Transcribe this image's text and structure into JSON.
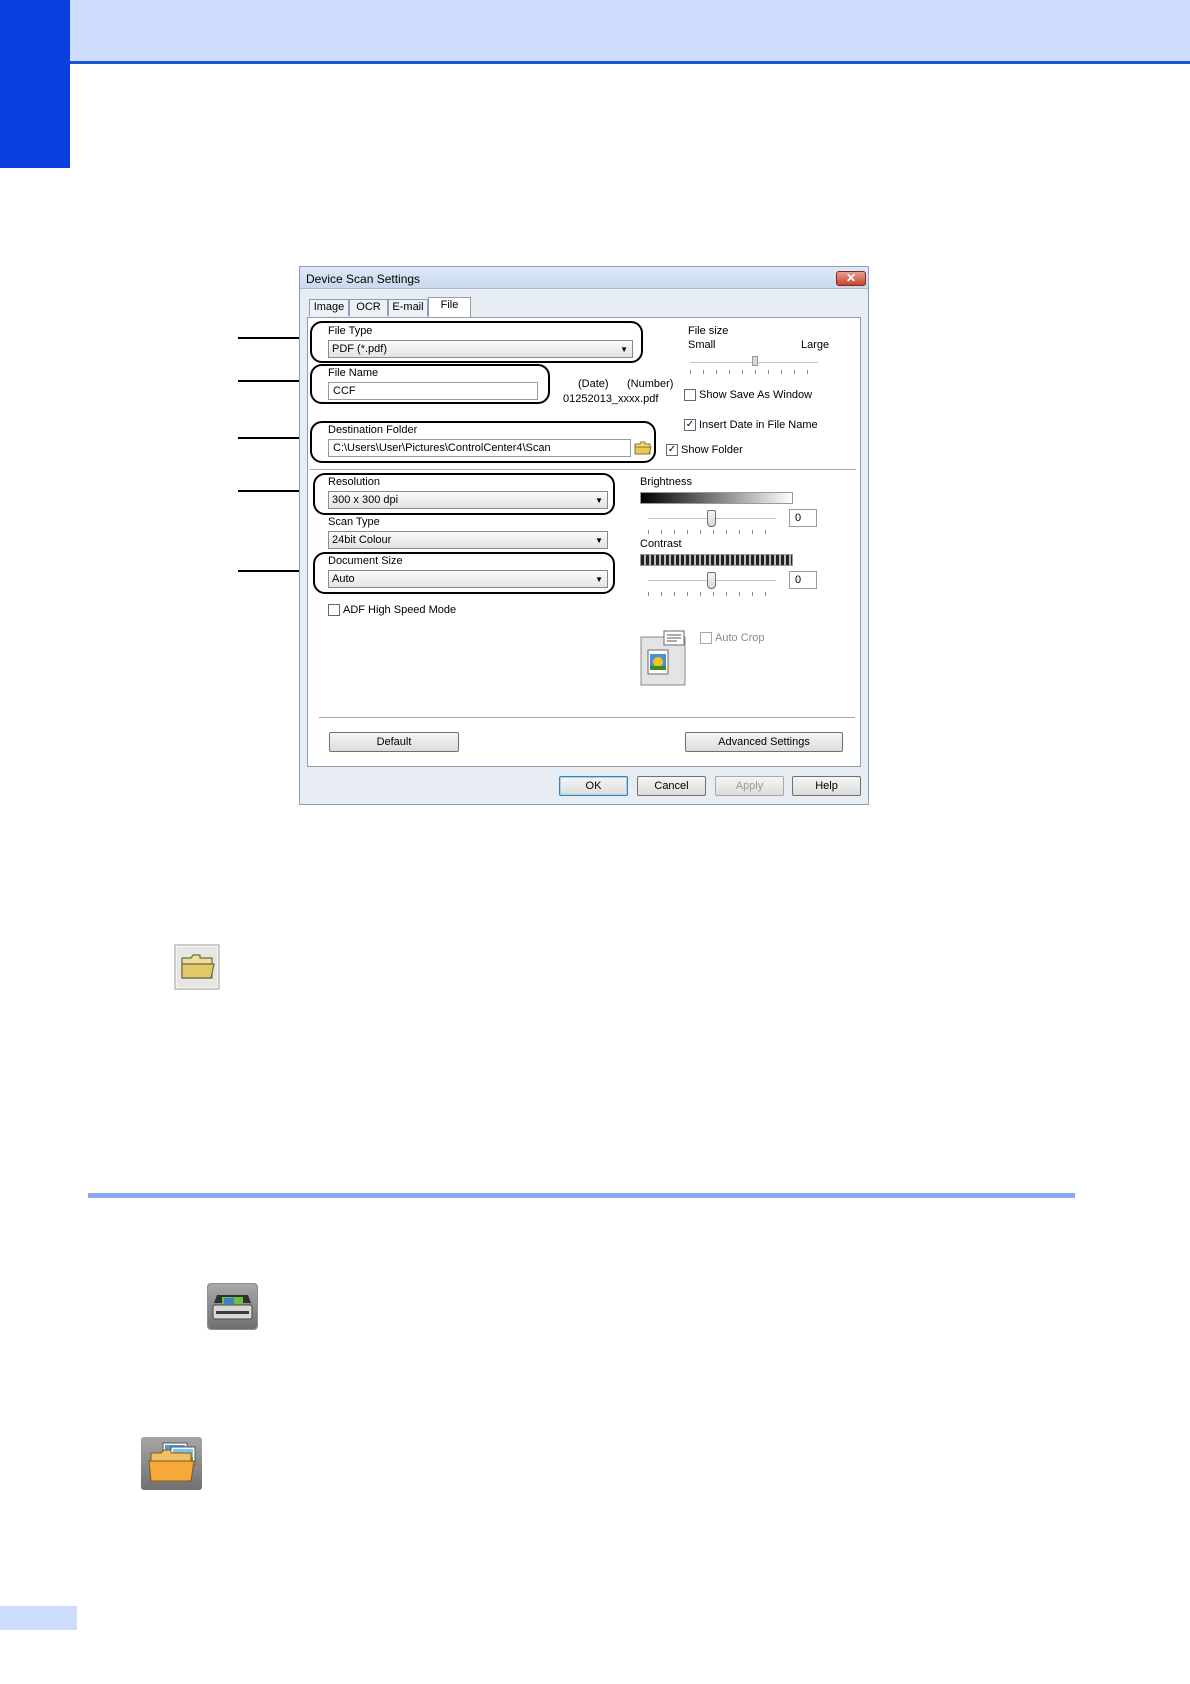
{
  "dialog": {
    "title": "Device Scan Settings",
    "close_glyph": "✕",
    "tabs": [
      {
        "label": "Image"
      },
      {
        "label": "OCR"
      },
      {
        "label": "E-mail"
      },
      {
        "label": "File"
      }
    ],
    "active_tab": "File",
    "file_type": {
      "label": "File Type",
      "value": "PDF (*.pdf)"
    },
    "file_name": {
      "label": "File Name",
      "value": "CCF"
    },
    "file_name_preview": {
      "date_label": "(Date)",
      "number_label": "(Number)",
      "example": "01252013_xxxx.pdf"
    },
    "file_size": {
      "label": "File size",
      "small_label": "Small",
      "large_label": "Large"
    },
    "show_save_as_window": {
      "label": "Show Save As Window",
      "checked": false
    },
    "insert_date": {
      "label": "Insert Date in File Name",
      "checked": true
    },
    "destination_folder": {
      "label": "Destination Folder",
      "value": "C:\\Users\\User\\Pictures\\ControlCenter4\\Scan"
    },
    "show_folder": {
      "label": "Show Folder",
      "checked": true
    },
    "resolution": {
      "label": "Resolution",
      "value": "300 x 300 dpi"
    },
    "scan_type": {
      "label": "Scan Type",
      "value": "24bit Colour"
    },
    "document_size": {
      "label": "Document Size",
      "value": "Auto"
    },
    "adf_high_speed": {
      "label": "ADF High Speed Mode",
      "checked": false
    },
    "brightness": {
      "label": "Brightness",
      "value": "0"
    },
    "contrast": {
      "label": "Contrast",
      "value": "0"
    },
    "auto_crop": {
      "label": "Auto Crop",
      "checked": false
    },
    "buttons": {
      "default": "Default",
      "advanced_settings": "Advanced Settings",
      "ok": "OK",
      "cancel": "Cancel",
      "apply": "Apply",
      "help": "Help"
    },
    "check_glyph": "✓",
    "arrow_glyph": "▼"
  },
  "icons": [
    "folder-icon",
    "scan-icon",
    "photo-folder-icon"
  ],
  "colors": {
    "header_band": "#cddcfa",
    "chapter_tab": "#0a3fe0",
    "section_rule": "#8aa9ef"
  }
}
